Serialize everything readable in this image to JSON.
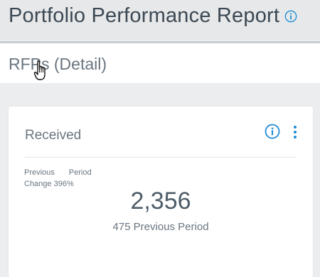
{
  "header": {
    "title": "Portfolio Performance Report"
  },
  "subheader": {
    "title": "RFPs (Detail)"
  },
  "card": {
    "title": "Received",
    "previous_label": "Previous",
    "period_label": "Period",
    "change_label": "Change",
    "change_value": "396%",
    "value": "2,356",
    "previous_period_text": "475 Previous Period"
  },
  "colors": {
    "accent": "#1f8dd6",
    "text": "#3d4a56",
    "muted": "#6a7580",
    "background": "#ebedee"
  },
  "icons": {
    "header_info": "info-icon",
    "card_info": "info-icon",
    "card_menu": "vertical-dots-icon",
    "cursor": "hand-pointer-icon"
  }
}
